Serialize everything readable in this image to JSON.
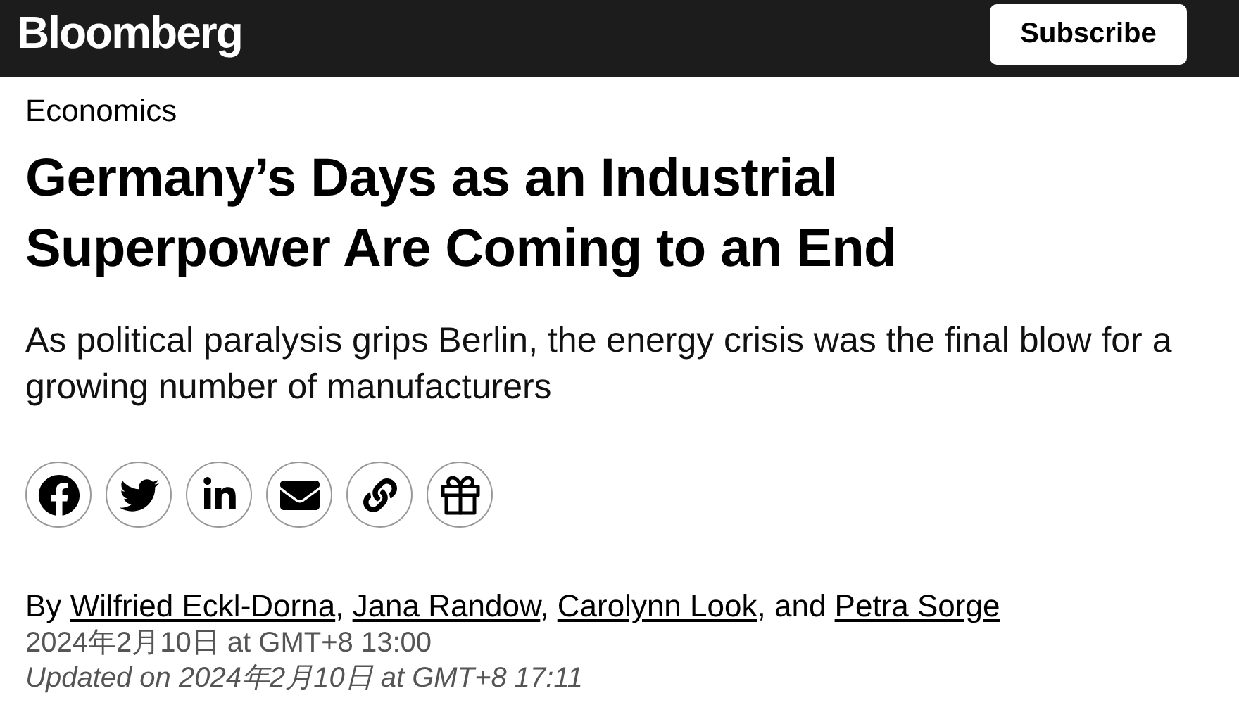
{
  "header": {
    "logo": "Bloomberg",
    "subscribe": "Subscribe"
  },
  "section": "Economics",
  "headline": "Germany’s Days as an Industrial Superpower Are Coming to an End",
  "subheadline": "As political paralysis grips Berlin, the energy crisis was the final blow for a growing number of manufacturers",
  "share_buttons": [
    {
      "kind": "facebook"
    },
    {
      "kind": "twitter"
    },
    {
      "kind": "linkedin"
    },
    {
      "kind": "email"
    },
    {
      "kind": "link"
    },
    {
      "kind": "gift"
    }
  ],
  "byline": {
    "prefix": "By",
    "authors": [
      "Wilfried Eckl-Dorna",
      "Jana Randow",
      "Carolynn Look",
      "Petra Sorge"
    ],
    "separator": ",",
    "last_separator": ", and"
  },
  "published": "2024年2月10日 at GMT+8 13:00",
  "updated": "Updated on 2024年2月10日 at GMT+8 17:11"
}
